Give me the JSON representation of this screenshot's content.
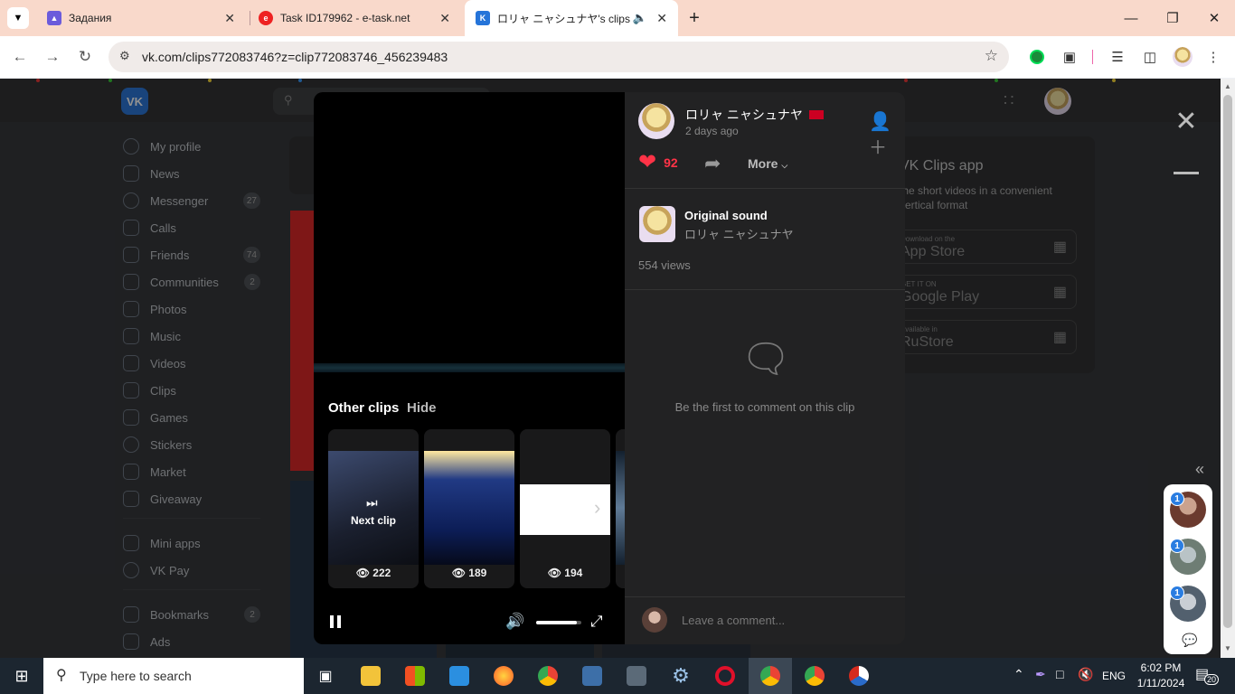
{
  "browser": {
    "tabs": [
      {
        "title": "Задания"
      },
      {
        "title": "Task ID179962 - e-task.net"
      },
      {
        "title": "ロリャ ニャシュナヤ's clips"
      }
    ],
    "url": "vk.com/clips772083746?z=clip772083746_456239483"
  },
  "sidebar": {
    "items": [
      {
        "label": "My profile",
        "badge": ""
      },
      {
        "label": "News",
        "badge": ""
      },
      {
        "label": "Messenger",
        "badge": "27"
      },
      {
        "label": "Calls",
        "badge": ""
      },
      {
        "label": "Friends",
        "badge": "74"
      },
      {
        "label": "Communities",
        "badge": "2"
      },
      {
        "label": "Photos",
        "badge": ""
      },
      {
        "label": "Music",
        "badge": ""
      },
      {
        "label": "Videos",
        "badge": ""
      },
      {
        "label": "Clips",
        "badge": ""
      },
      {
        "label": "Games",
        "badge": ""
      },
      {
        "label": "Stickers",
        "badge": ""
      },
      {
        "label": "Market",
        "badge": ""
      },
      {
        "label": "Giveaway",
        "badge": ""
      },
      {
        "label": "Mini apps",
        "badge": ""
      },
      {
        "label": "VK Pay",
        "badge": ""
      },
      {
        "label": "Bookmarks",
        "badge": "2"
      },
      {
        "label": "Ads",
        "badge": ""
      }
    ]
  },
  "right_panel": {
    "title": "VK Clips app",
    "desc1": "the short videos in a convenient",
    "desc2": "vertical format",
    "stores": [
      {
        "small": "Download on the",
        "name": "App Store"
      },
      {
        "small": "GET IT ON",
        "name": "Google Play"
      },
      {
        "small": "Available in",
        "name": "RuStore"
      }
    ]
  },
  "clip": {
    "author": "ロリャ ニャシュナヤ",
    "posted": "2 days ago",
    "likes": "92",
    "more_label": "More",
    "sound_title": "Original sound",
    "sound_author": "ロリャ ニャシュナヤ",
    "views": "554 views",
    "empty_comments": "Be the first to comment on this clip",
    "comment_placeholder": "Leave a comment..."
  },
  "other_clips": {
    "title": "Other clips",
    "hide_label": "Hide",
    "next_label": "Next clip",
    "items": [
      {
        "views": "222"
      },
      {
        "views": "189"
      },
      {
        "views": "194"
      }
    ]
  },
  "video_volume": 0.9,
  "chat_badges": [
    "1",
    "1",
    "1"
  ],
  "taskbar": {
    "search_placeholder": "Type here to search",
    "lang": "ENG",
    "time": "6:02 PM",
    "date": "1/11/2024",
    "notifications": "20"
  }
}
